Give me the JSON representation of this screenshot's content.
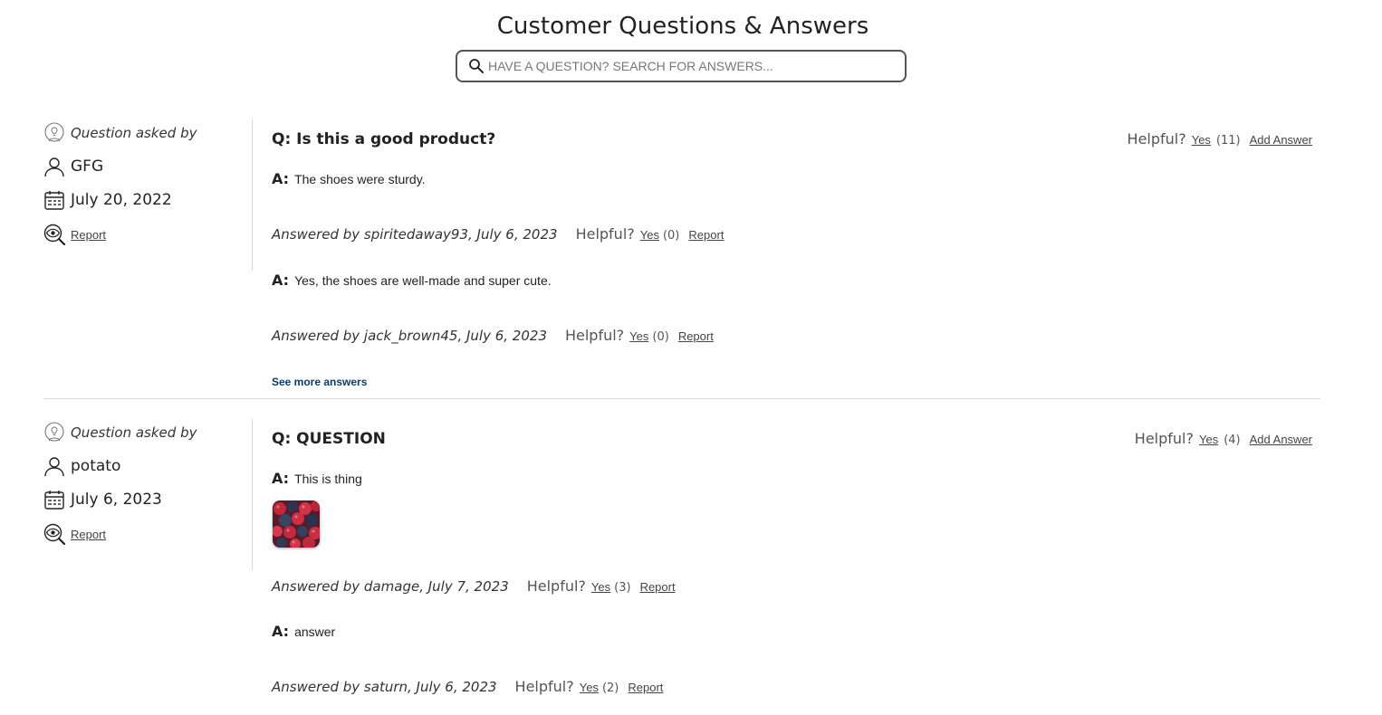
{
  "page": {
    "title": "Customer Questions & Answers",
    "search_placeholder": "HAVE A QUESTION? SEARCH FOR ANSWERS..."
  },
  "questions": [
    {
      "asked_by_label": "Question asked by",
      "user": "GFG",
      "date": "July 20, 2022",
      "report_label": "Report",
      "title": "Q: Is this a good product?",
      "helpful_label": "Helpful?",
      "yes_label": "Yes",
      "helpful_count": "(11)",
      "add_answer_label": "Add Answer",
      "answers": [
        {
          "prefix": "A:",
          "body": "The shoes were sturdy.",
          "answered_by": "Answered by spiritedaway93, July 6, 2023",
          "helpful_label": "Helpful?",
          "yes_label": "Yes",
          "helpful_count": "(0)",
          "report_label": "Report"
        },
        {
          "prefix": "A:",
          "body": "Yes, the shoes are well-made and super cute.",
          "answered_by": "Answered by jack_brown45, July 6, 2023",
          "helpful_label": "Helpful?",
          "yes_label": "Yes",
          "helpful_count": "(0)",
          "report_label": "Report"
        }
      ],
      "see_more_label": "See more answers"
    },
    {
      "asked_by_label": "Question asked by",
      "user": "potato",
      "date": "July 6, 2023",
      "report_label": "Report",
      "title": "Q: QUESTION",
      "helpful_label": "Helpful?",
      "yes_label": "Yes",
      "helpful_count": "(4)",
      "add_answer_label": "Add Answer",
      "answers": [
        {
          "prefix": "A:",
          "body": "This is thing",
          "photo": "berries-thumbnail",
          "answered_by": "Answered by damage, July 7, 2023",
          "helpful_label": "Helpful?",
          "yes_label": "Yes",
          "helpful_count": "(3)",
          "report_label": "Report"
        },
        {
          "prefix": "A:",
          "body": "answer",
          "answered_by": "Answered by saturn, July 6, 2023",
          "helpful_label": "Helpful?",
          "yes_label": "Yes",
          "helpful_count": "(2)",
          "report_label": "Report"
        }
      ]
    }
  ],
  "icons": {
    "search": "search-icon",
    "asker": "lightbulb-head-icon",
    "user": "user-icon",
    "date": "calendar-icon",
    "report": "eye-magnifier-icon"
  },
  "colors": {
    "see_more_link": "#0b3b66",
    "divider": "#d8d8d8"
  }
}
